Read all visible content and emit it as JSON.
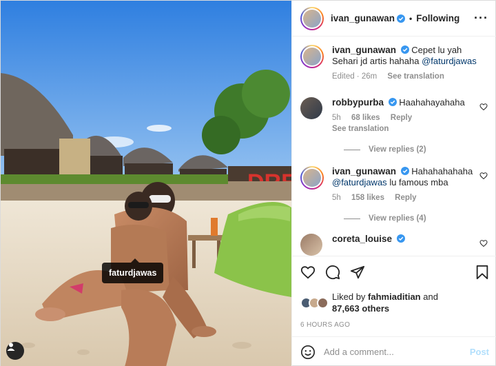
{
  "header": {
    "username": "ivan_gunawan",
    "separator": "•",
    "follow_state": "Following",
    "more_label": "···"
  },
  "photo": {
    "tag_username": "faturdjawas",
    "sign_text": "DRE"
  },
  "caption": {
    "username": "ivan_gunawan",
    "text": "Cepet lu yah Sehari jd artis hahaha",
    "mention": "@faturdjawas",
    "edited": "Edited · 26m",
    "see_translation": "See translation"
  },
  "comments": [
    {
      "username": "robbypurba",
      "text": "Haahahayahaha",
      "age": "5h",
      "likes": "68 likes",
      "reply": "Reply",
      "see_translation": "See translation",
      "view_replies": "View replies (2)"
    },
    {
      "username": "ivan_gunawan",
      "text_mention": "@faturdjawas",
      "text_start": "Hahahahahaha",
      "text_end": "lu famous mba",
      "age": "5h",
      "likes": "158 likes",
      "reply": "Reply",
      "view_replies": "View replies (4)"
    },
    {
      "username": "coreta_louise"
    }
  ],
  "actions": {
    "liked_by_prefix": "Liked by",
    "liked_by_user": "fahmiaditian",
    "and": "and",
    "others": "87,663 others",
    "time_ago": "6 HOURS AGO"
  },
  "comment_box": {
    "placeholder": "Add a comment...",
    "post_label": "Post"
  },
  "colors": {
    "verified": "#3897f0",
    "mention": "#00376b",
    "muted": "#8e8e8e",
    "post_disabled": "#b2dffc"
  }
}
